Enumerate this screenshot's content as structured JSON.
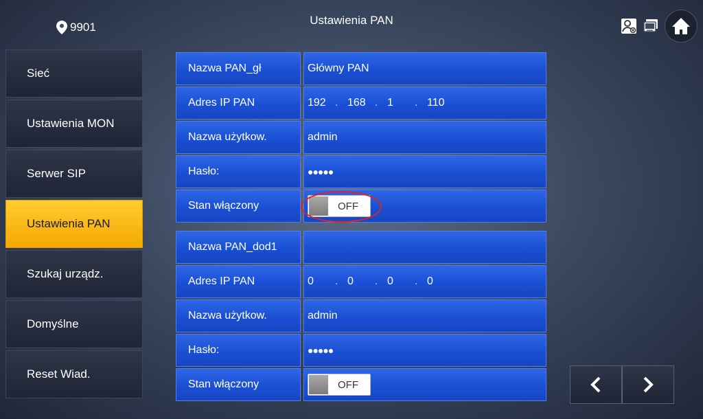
{
  "header": {
    "location": "9901",
    "title": "Ustawienia PAN"
  },
  "sidebar": {
    "items": [
      {
        "label": "Sieć"
      },
      {
        "label": "Ustawienia MON"
      },
      {
        "label": "Serwer SIP"
      },
      {
        "label": "Ustawienia PAN",
        "active": true
      },
      {
        "label": "Szukaj urządz."
      },
      {
        "label": "Domyślne"
      },
      {
        "label": "Reset Wiad."
      }
    ]
  },
  "main_pan": {
    "name_label": "Nazwa PAN_gł",
    "name_value": "Główny PAN",
    "ip_label": "Adres IP PAN",
    "ip": [
      "192",
      "168",
      "1",
      "110"
    ],
    "user_label": "Nazwa użytkow.",
    "user_value": "admin",
    "password_label": "Hasło:",
    "password_value": "●●●●●",
    "enabled_label": "Stan włączony",
    "enabled_value": "OFF"
  },
  "extra_pan": {
    "name_label": "Nazwa PAN_dod1",
    "name_value": "",
    "ip_label": "Adres IP PAN",
    "ip": [
      "0",
      "0",
      "0",
      "0"
    ],
    "user_label": "Nazwa użytkow.",
    "user_value": "admin",
    "password_label": "Hasło:",
    "password_value": "●●●●●",
    "enabled_label": "Stan włączony",
    "enabled_value": "OFF"
  },
  "colors": {
    "accent": "#f5a800",
    "cell_blue": "#1a4fd4",
    "highlight": "#e3241b"
  },
  "icons": [
    "location-pin-icon",
    "contacts-icon",
    "monitor-icon",
    "home-icon",
    "chevron-left-icon",
    "chevron-right-icon"
  ]
}
